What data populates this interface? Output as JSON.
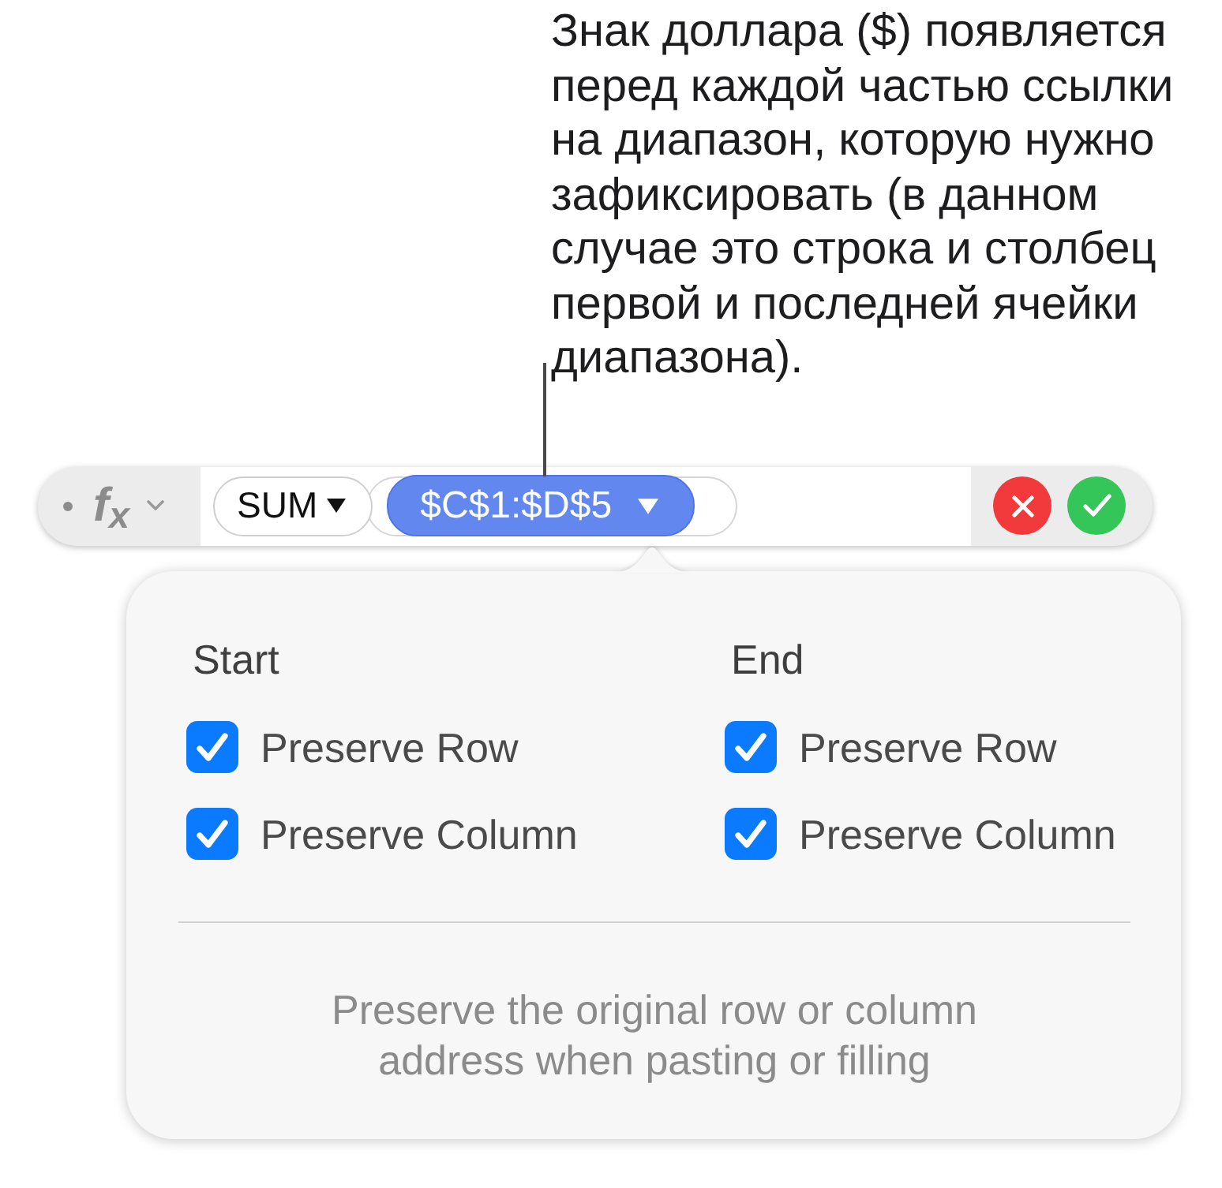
{
  "callout": {
    "text": "Знак доллара ($) появляется\nперед каждой частью ссылки\nна диапазон, которую нужно\nзафиксировать (в данном\nслучае это строка и столбец\nпервой и последней ячейки\nдиапазона)."
  },
  "formula_bar": {
    "formula_symbol": "f$_{x}$",
    "function_token": {
      "label": "SUM"
    },
    "range_token": {
      "label": "$C$1:$D$5",
      "selected": true
    }
  },
  "popover": {
    "columns": [
      {
        "heading": "Start",
        "options": [
          {
            "label": "Preserve Row",
            "checked": true
          },
          {
            "label": "Preserve Column",
            "checked": true
          }
        ]
      },
      {
        "heading": "End",
        "options": [
          {
            "label": "Preserve Row",
            "checked": true
          },
          {
            "label": "Preserve Column",
            "checked": true
          }
        ]
      }
    ],
    "description": "Preserve the original row or column\naddress when pasting or filling"
  }
}
